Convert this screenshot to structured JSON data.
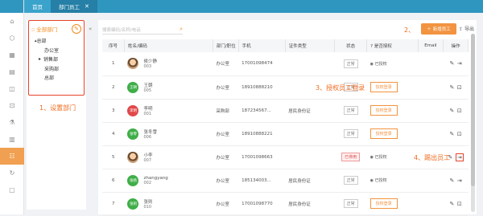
{
  "tabs": [
    {
      "label": "首页"
    },
    {
      "label": "部门员工",
      "close": "✕"
    }
  ],
  "rail_icons": [
    "home-icon",
    "cube-icon",
    "building-icon",
    "calendar-icon",
    "box-icon",
    "lock-icon",
    "flask-icon",
    "chart-icon",
    "staff-icon",
    "refresh-icon",
    "doc-icon"
  ],
  "sidebar": {
    "header": "全部部门",
    "items": [
      {
        "label": "总部",
        "level": 1
      },
      {
        "label": "办公室",
        "level": 2
      },
      {
        "label": "销售部",
        "level": 2,
        "arrow": "▸"
      },
      {
        "label": "采购部",
        "level": 2
      },
      {
        "label": "总部",
        "level": 2
      }
    ]
  },
  "annotations": {
    "a1": "1、设置部门",
    "a2": "2、",
    "a3": "3、授权员工登录",
    "a4": "4、踢出员工"
  },
  "search": {
    "placeholder": "搜索编码/名称/电话"
  },
  "buttons": {
    "new_employee": "新增员工",
    "export": "导出",
    "collapse": "«"
  },
  "table": {
    "headers": [
      "序号",
      "姓名/编码",
      "部门/职位",
      "手机",
      "证件类型",
      "状态",
      "是否授权",
      "Email",
      "操作"
    ],
    "rows": [
      {
        "no": "1",
        "avatar": "",
        "photo": true,
        "name": "侯少静",
        "code": "003",
        "dept": "办公室",
        "phone": "17001098474",
        "cert": "",
        "status": "正常",
        "disabled": false,
        "perm": "已授权",
        "granted": true,
        "hl": false
      },
      {
        "no": "2",
        "avatar": "王朝",
        "color": "#3fae48",
        "name": "王朝",
        "code": "005",
        "dept": "办公室",
        "phone": "18910888210",
        "cert": "",
        "status": "正常",
        "disabled": false,
        "perm": "授权登录",
        "granted": false,
        "hl": false
      },
      {
        "no": "3",
        "avatar": "李明",
        "color": "#e0494b",
        "name": "李明",
        "code": "001",
        "dept": "采购部",
        "phone": "187234567...",
        "cert": "居民身份证",
        "status": "正常",
        "disabled": false,
        "perm": "授权登录",
        "granted": false,
        "hl": false
      },
      {
        "no": "4",
        "avatar": "张零",
        "color": "#3fae48",
        "name": "张冬雪",
        "code": "006",
        "dept": "办公室",
        "phone": "18910888221",
        "cert": "",
        "status": "正常",
        "disabled": false,
        "perm": "授权登录",
        "granted": false,
        "hl": false
      },
      {
        "no": "5",
        "avatar": "",
        "photo": true,
        "name": "小李",
        "code": "007",
        "dept": "办公室",
        "phone": "17001098663",
        "cert": "",
        "status": "已停用",
        "disabled": true,
        "perm": "已授权",
        "granted": true,
        "hl": true
      },
      {
        "no": "6",
        "avatar": "张扬",
        "color": "#3fae48",
        "name": "zhangyang",
        "code": "002",
        "dept": "办公室",
        "phone": "185134003...",
        "cert": "居民身份证",
        "status": "正常",
        "disabled": false,
        "perm": "已授权",
        "granted": true,
        "hl": false
      },
      {
        "no": "7",
        "avatar": "张则",
        "color": "#3fae48",
        "name": "张则",
        "code": "010",
        "dept": "办公室",
        "phone": "17001098770",
        "cert": "居民身份证",
        "status": "正常",
        "disabled": false,
        "perm": "授权登录",
        "granted": false,
        "hl": false
      }
    ]
  }
}
